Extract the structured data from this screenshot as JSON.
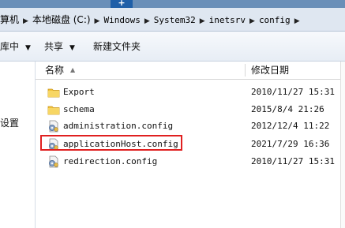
{
  "address": {
    "crumbs": [
      "算机",
      "本地磁盘 (C:)",
      "Windows",
      "System32",
      "inetsrv",
      "config"
    ]
  },
  "toolbar": {
    "organize_label": "库中",
    "share_label": "共享",
    "new_folder_label": "新建文件夹"
  },
  "nav": {
    "item_label": "设置"
  },
  "columns": {
    "name": "名称",
    "date": "修改日期"
  },
  "files": [
    {
      "name": "Export",
      "date": "2010/11/27 15:31",
      "icon": "folder-icon"
    },
    {
      "name": "schema",
      "date": "2015/8/4 21:26",
      "icon": "folder-icon"
    },
    {
      "name": "administration.config",
      "date": "2012/12/4 11:22",
      "icon": "config-file-icon"
    },
    {
      "name": "applicationHost.config",
      "date": "2021/7/29 16:36",
      "icon": "config-file-icon"
    },
    {
      "name": "redirection.config",
      "date": "2010/11/27 15:31",
      "icon": "config-file-icon"
    }
  ],
  "colors": {
    "highlight": "#e02020",
    "address_bg": "#dfe7f1"
  }
}
